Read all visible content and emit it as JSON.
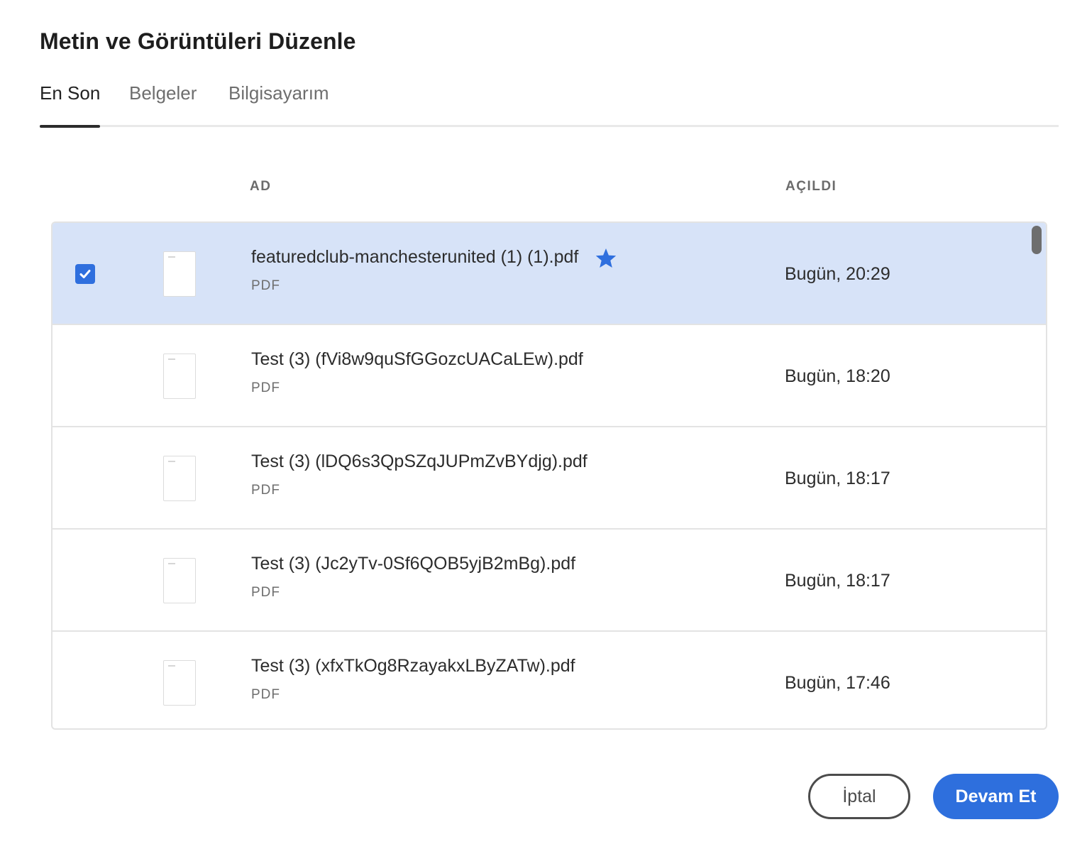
{
  "dialog": {
    "title": "Metin ve Görüntüleri Düzenle"
  },
  "tabs": [
    {
      "label": "En Son",
      "active": true
    },
    {
      "label": "Belgeler",
      "active": false
    },
    {
      "label": "Bilgisayarım",
      "active": false
    }
  ],
  "columns": {
    "name": "AD",
    "opened": "AÇILDI"
  },
  "files": [
    {
      "name": "featuredclub-manchesterunited (1) (1).pdf",
      "type": "PDF",
      "opened": "Bugün, 20:29",
      "selected": true,
      "starred": true
    },
    {
      "name": "Test (3) (fVi8w9quSfGGozcUACaLEw).pdf",
      "type": "PDF",
      "opened": "Bugün, 18:20",
      "selected": false,
      "starred": false
    },
    {
      "name": "Test (3) (lDQ6s3QpSZqJUPmZvBYdjg).pdf",
      "type": "PDF",
      "opened": "Bugün, 18:17",
      "selected": false,
      "starred": false
    },
    {
      "name": "Test (3) (Jc2yTv-0Sf6QOB5yjB2mBg).pdf",
      "type": "PDF",
      "opened": "Bugün, 18:17",
      "selected": false,
      "starred": false
    },
    {
      "name": "Test (3) (xfxTkOg8RzayakxLByZATw).pdf",
      "type": "PDF",
      "opened": "Bugün, 17:46",
      "selected": false,
      "starred": false
    }
  ],
  "icons": {
    "checkbox": "checkmark-icon",
    "star": "star-icon",
    "thumbnail": "pdf-thumbnail-icon"
  },
  "buttons": {
    "cancel": "İptal",
    "continue": "Devam Et"
  },
  "colors": {
    "accent": "#2e6fdd",
    "selected_row": "#d7e3f8",
    "star": "#2f6fde"
  }
}
